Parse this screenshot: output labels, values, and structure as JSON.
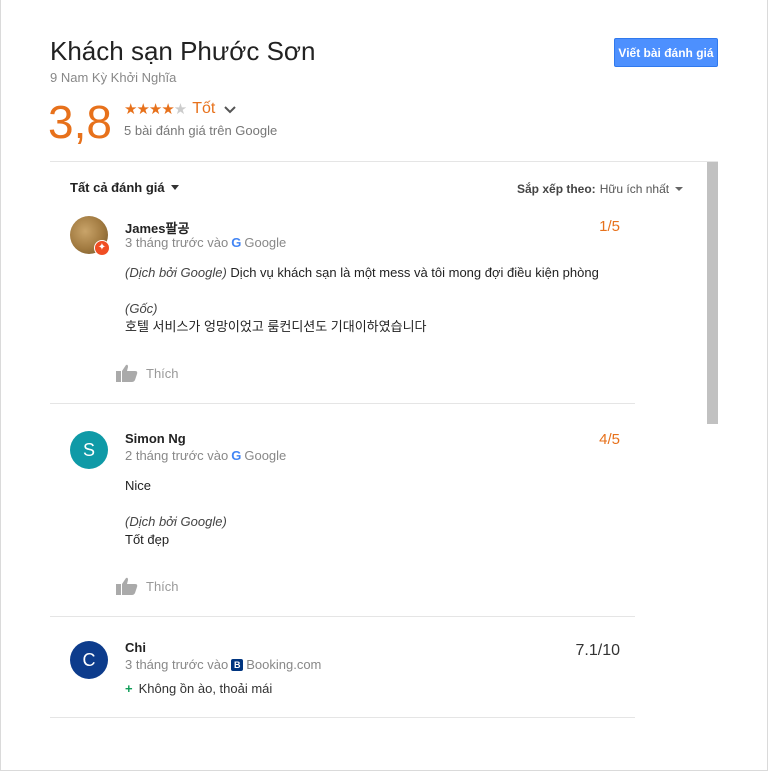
{
  "hotel": {
    "name": "Khách sạn Phước Sơn",
    "address": "9 Nam Kỳ Khởi Nghĩa",
    "write_review_label": "Viết bài đánh giá",
    "rating": "3,8",
    "rating_value": 3.8,
    "stars_filled": 4,
    "stars_total": 5,
    "rating_word": "Tốt",
    "review_count_text": "5 bài đánh giá trên Google"
  },
  "toolbar": {
    "filter_label": "Tất cả đánh giá",
    "sort_label": "Sắp xếp theo:",
    "sort_value": "Hữu ích nhất"
  },
  "reviews": [
    {
      "author": "James팔공",
      "time": "3 tháng trước vào",
      "source": "Google",
      "score": "1/5",
      "translated_note": "(Dịch bởi Google)",
      "translated_text": "Dịch vụ khách sạn là một mess và tôi mong đợi điều kiện phòng",
      "original_note": "(Gốc)",
      "original_text": "호텔 서비스가 엉망이었고 룸컨디션도 기대이하였습니다",
      "like_label": "Thích"
    },
    {
      "author": "Simon Ng",
      "avatar_letter": "S",
      "avatar_color": "#0f9aa7",
      "time": "2 tháng trước vào",
      "source": "Google",
      "score": "4/5",
      "original_text": "Nice",
      "translated_note": "(Dịch bởi Google)",
      "translated_text": "Tốt đẹp",
      "like_label": "Thích"
    },
    {
      "author": "Chi",
      "avatar_letter": "C",
      "avatar_color": "#0d3c8c",
      "time": "3 tháng trước vào",
      "source": "Booking.com",
      "score": "7.1/10",
      "positive_text": "Không ồn ào, thoải mái"
    }
  ],
  "colors": {
    "accent": "#e7711b",
    "button": "#4d90fe"
  }
}
